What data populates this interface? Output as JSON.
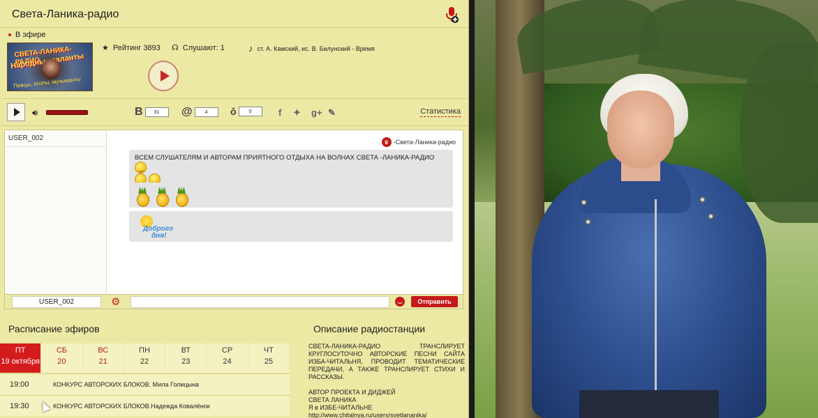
{
  "header": {
    "title": "Света-Ланика-радио"
  },
  "status": {
    "on_air": "В эфире"
  },
  "logo": {
    "line1": "СВЕТА-ЛАНИКА-РАДИО",
    "line2": "Народные таланты",
    "line3": "Певцы, поэты, музыканты"
  },
  "station": {
    "rating": "Рейтинг 3893",
    "listeners": "Слушают: 1",
    "now_playing": "ст. А. Камский, ис. В. Билунский - Время"
  },
  "controls": {
    "counts": {
      "vk": "31",
      "mail": "4",
      "ok": "0"
    },
    "stats_label": "Статистика",
    "volume_level": 1.0
  },
  "chat": {
    "users": [
      "USER_002"
    ],
    "sender": "-Света-Ланика-радио",
    "message_text": "ВСЕМ СЛУШАТЕЛЯМ И АВТОРАМ ПРИЯТНОГО ОТДЫХА НА ВОЛНАХ СВЕТА -ЛАНИКА-РАДИО",
    "sticker_line1": "Доброго",
    "sticker_line2": "дня!",
    "nick": "USER_002",
    "send_label": "Отправить",
    "input_placeholder": ""
  },
  "schedule": {
    "title": "Расписание эфиров",
    "days": [
      {
        "name": "ПТ",
        "date": "19 октября"
      },
      {
        "name": "СБ",
        "date": "20"
      },
      {
        "name": "ВС",
        "date": "21"
      },
      {
        "name": "ПН",
        "date": "22"
      },
      {
        "name": "ВТ",
        "date": "23"
      },
      {
        "name": "СР",
        "date": "24"
      },
      {
        "name": "ЧТ",
        "date": "25"
      }
    ],
    "rows": [
      {
        "time": "19:00",
        "text": "КОНКУРС АВТОРСКИХ БЛОКОВ. Мила Голицына"
      },
      {
        "time": "19:30",
        "text": "КОНКУРС АВТОРСКИХ БЛОКОВ.Надежда Ковалёнок"
      }
    ]
  },
  "description": {
    "title": "Описание радиостанции",
    "p1": "СВЕТА-ЛАНИКА-РАДИО ТРАНСЛИРУЕТ КРУГЛОСУТОЧНО АВТОРСКИЕ ПЕСНИ САЙТА ИЗБА-ЧИТАЛЬНЯ, ПРОВОДИТ ТЕМАТИЧЕСКИЕ ПЕРЕДАЧИ, А ТАКЖЕ ТРАНСЛИРУЕТ СТИХИ И РАССКАЗЫ.",
    "p2_l1": "АВТОР ПРОЕКТА И ДИДЖЕЙ",
    "p2_l2": "СВЕТА ЛАНИКА",
    "p2_l3": "Я в ИЗБЕ-ЧИТАЛЬНЕ",
    "p2_l4": "http://www.chitalnya.ru/users/svetlananika/"
  },
  "colors": {
    "accent": "#c41a1a",
    "panel": "#ece9a4"
  },
  "icons": [
    "microphone-icon",
    "star-icon",
    "headphones-icon",
    "music-note-icon",
    "play-icon",
    "volume-icon",
    "gear-icon",
    "smile-icon",
    "crown-icon"
  ]
}
